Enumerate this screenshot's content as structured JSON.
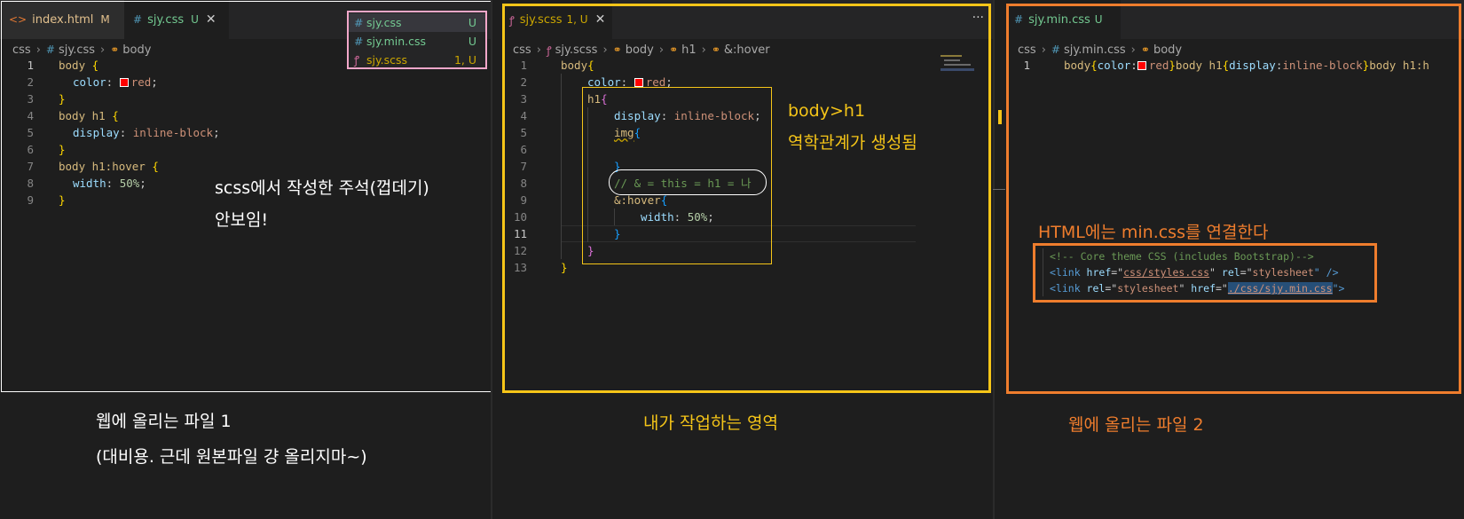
{
  "colors": {
    "pane_left_border": "#ffffff",
    "pane_middle_border": "#f5c518",
    "pane_right_border": "#ef7d2d",
    "pink_box": "#f2a7c9",
    "hint_yellow": "#f5c518",
    "hint_orange": "#ef7d2d"
  },
  "left": {
    "tabs": [
      {
        "icon": "html-icon",
        "glyph": "<>",
        "label": "index.html",
        "status": "M"
      },
      {
        "icon": "css-icon",
        "glyph": "#",
        "label": "sjy.css",
        "status": "U",
        "close": "✕"
      }
    ],
    "crumbs": {
      "folder": "css",
      "file": "sjy.css",
      "symbol": "body"
    },
    "file_list": [
      {
        "icon": "css-icon",
        "glyph": "#",
        "label": "sjy.css",
        "status": "U"
      },
      {
        "icon": "css-icon",
        "glyph": "#",
        "label": "sjy.min.css",
        "status": "U"
      },
      {
        "icon": "sass-icon",
        "glyph": "ꝭ",
        "label": "sjy.scss",
        "status": "1, U"
      }
    ],
    "line_numbers": [
      "1",
      "2",
      "3",
      "4",
      "5",
      "6",
      "7",
      "8",
      "9"
    ],
    "code": {
      "l1_sel": "body ",
      "l1_brace": "{",
      "l2_prop": "color",
      "l2_colon": ": ",
      "l2_val": "red",
      "l2_semi": ";",
      "l3_brace": "}",
      "l4_sel": "body h1 ",
      "l4_brace": "{",
      "l5_prop": "display",
      "l5_colon": ": ",
      "l5_val": "inline-block",
      "l5_semi": ";",
      "l6_brace": "}",
      "l7_sel": "body h1:hover ",
      "l7_brace": "{",
      "l8_prop": "width",
      "l8_colon": ": ",
      "l8_val": "50%",
      "l8_semi": ";",
      "l9_brace": "}"
    },
    "note_line1": "scss에서 작성한 주석(껍데기)",
    "note_line2": "안보임!",
    "caption_line1": "웹에 올리는 파일 1",
    "caption_line2": "(대비용. 근데 원본파일 걍 올리지마~)"
  },
  "middle": {
    "tab": {
      "icon": "sass-icon",
      "glyph": "ꝭ",
      "label": "sjy.scss",
      "status": "1, U",
      "close": "✕"
    },
    "more": "···",
    "crumbs": {
      "folder": "css",
      "file": "sjy.scss",
      "s1": "body",
      "s2": "h1",
      "s3": "&:hover"
    },
    "line_numbers": [
      "1",
      "2",
      "3",
      "4",
      "5",
      "6",
      "7",
      "8",
      "9",
      "10",
      "11",
      "12",
      "13"
    ],
    "code": {
      "l1_sel": "body",
      "l1_brace": "{",
      "l2_prop": "color",
      "l2_colon": ": ",
      "l2_val": "red",
      "l2_semi": ";",
      "l3_sel": "h1",
      "l3_brace": "{",
      "l4_prop": "display",
      "l4_colon": ": ",
      "l4_val": "inline-block",
      "l4_semi": ";",
      "l5_sel": "img",
      "l5_brace": "{",
      "l7_brace": "}",
      "l8_comment": "// & = this = h1 = 나",
      "l9_sel": "&:hover",
      "l9_brace": "{",
      "l10_prop": "width",
      "l10_colon": ": ",
      "l10_val": "50%",
      "l10_semi": ";",
      "l11_brace": "}",
      "l12_brace": "}",
      "l13_brace": "}"
    },
    "note_title": "body>h1",
    "note_sub": "역학관계가 생성됨",
    "caption": "내가 작업하는 영역"
  },
  "right": {
    "tab": {
      "icon": "css-icon",
      "glyph": "#",
      "label": "sjy.min.css",
      "status": "U"
    },
    "crumbs": {
      "folder": "css",
      "file": "sjy.min.css",
      "symbol": "body"
    },
    "line_numbers": [
      "1"
    ],
    "code": {
      "a": "body",
      "b": "{",
      "c": "color",
      "d": ":",
      "e": "red",
      "f": "}",
      "g": "body h1",
      "h": "{",
      "i": "display",
      "j": ":",
      "k": "inline-block",
      "l": "}",
      "m": "body h1:h"
    },
    "note": "HTML에는 min.css를 연결한다",
    "html_snippet": {
      "comment": "<!-- Core theme CSS (includes Bootstrap)-->",
      "l2_open": "<link ",
      "l2_attr1": "href",
      "l2_eq1": "=\"",
      "l2_val1": "css/styles.css",
      "l2_q1": "\" ",
      "l2_attr2": "rel",
      "l2_eq2": "=\"",
      "l2_val2": "stylesheet",
      "l2_close": "\" />",
      "l3_open": "<link ",
      "l3_attr1": "rel",
      "l3_eq1": "=\"",
      "l3_val1": "stylesheet",
      "l3_q1": "\" ",
      "l3_attr2": "href",
      "l3_eq2": "=\"",
      "l3_val2": "./css/sjy.min.css",
      "l3_close": "\">"
    },
    "caption": "웹에 올리는 파일 2"
  }
}
